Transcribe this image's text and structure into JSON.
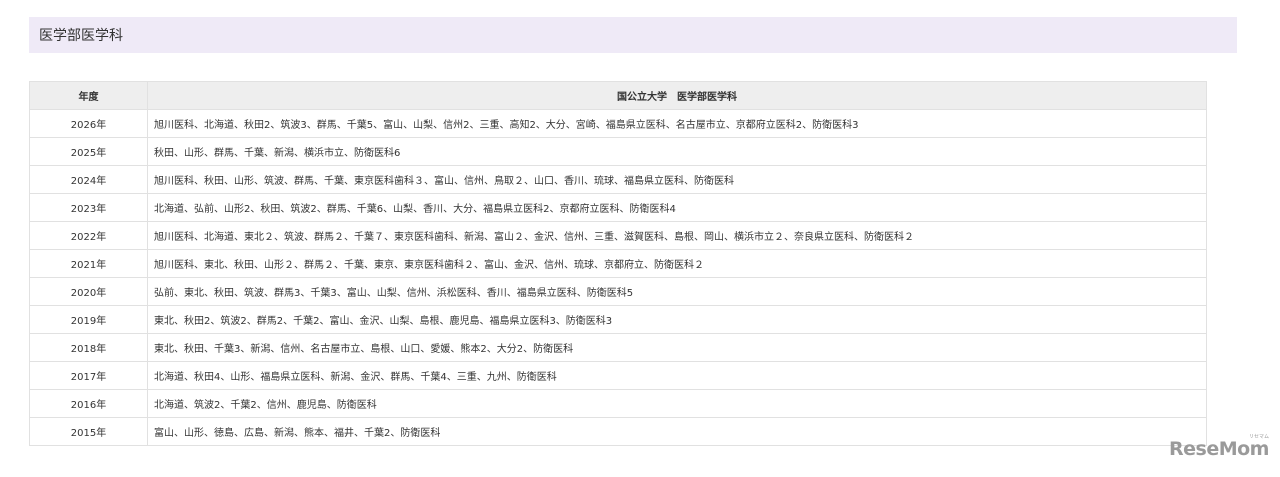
{
  "section": {
    "title": "医学部医学科"
  },
  "table": {
    "headers": {
      "year": "年度",
      "schools": "国公立大学　医学部医学科"
    },
    "rows": [
      {
        "year": "2026年",
        "schools": "旭川医科、北海道、秋田2、筑波3、群馬、千葉5、富山、山梨、信州2、三重、高知2、大分、宮崎、福島県立医科、名古屋市立、京都府立医科2、防衛医科3"
      },
      {
        "year": "2025年",
        "schools": "秋田、山形、群馬、千葉、新潟、横浜市立、防衛医科6"
      },
      {
        "year": "2024年",
        "schools": "旭川医科、秋田、山形、筑波、群馬、千葉、東京医科歯科３、富山、信州、鳥取２、山口、香川、琉球、福島県立医科、防衛医科"
      },
      {
        "year": "2023年",
        "schools": "北海道、弘前、山形2、秋田、筑波2、群馬、千葉6、山梨、香川、大分、福島県立医科2、京都府立医科、防衛医科4"
      },
      {
        "year": "2022年",
        "schools": "旭川医科、北海道、東北２、筑波、群馬２、千葉７、東京医科歯科、新潟、富山２、金沢、信州、三重、滋賀医科、島根、岡山、横浜市立２、奈良県立医科、防衛医科２"
      },
      {
        "year": "2021年",
        "schools": "旭川医科、東北、秋田、山形２、群馬２、千葉、東京、東京医科歯科２、富山、金沢、信州、琉球、京都府立、防衛医科２"
      },
      {
        "year": "2020年",
        "schools": "弘前、東北、秋田、筑波、群馬3、千葉3、富山、山梨、信州、浜松医科、香川、福島県立医科、防衛医科5"
      },
      {
        "year": "2019年",
        "schools": "東北、秋田2、筑波2、群馬2、千葉2、富山、金沢、山梨、島根、鹿児島、福島県立医科3、防衛医科3"
      },
      {
        "year": "2018年",
        "schools": "東北、秋田、千葉3、新潟、信州、名古屋市立、島根、山口、愛媛、熊本2、大分2、防衛医科"
      },
      {
        "year": "2017年",
        "schools": "北海道、秋田4、山形、福島県立医科、新潟、金沢、群馬、千葉4、三重、九州、防衛医科"
      },
      {
        "year": "2016年",
        "schools": "北海道、筑波2、千葉2、信州、鹿児島、防衛医科"
      },
      {
        "year": "2015年",
        "schools": "富山、山形、徳島、広島、新潟、熊本、福井、千葉2、防衛医科"
      }
    ]
  },
  "logo": {
    "text": "ReseMom",
    "sub": "リセマム"
  }
}
